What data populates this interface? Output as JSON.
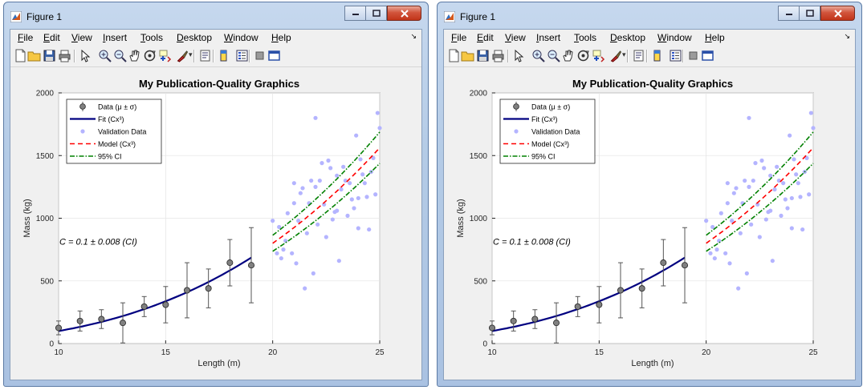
{
  "windows": [
    {
      "id": "left",
      "title": "Figure 1",
      "menu": [
        "File",
        "Edit",
        "View",
        "Insert",
        "Tools",
        "Desktop",
        "Window",
        "Help"
      ],
      "toolbar_icons": [
        "new-figure-icon",
        "open-file-icon",
        "save-icon",
        "print-icon",
        "edit-plot-icon",
        "zoom-in-icon",
        "zoom-out-icon",
        "pan-icon",
        "rotate-3d-icon",
        "data-cursor-icon",
        "brush-icon",
        "link-plot-icon",
        "insert-colorbar-icon",
        "insert-legend-icon",
        "hide-plot-tools-icon",
        "show-plot-tools-icon"
      ]
    },
    {
      "id": "right",
      "title": "Figure 1",
      "menu": [
        "File",
        "Edit",
        "View",
        "Insert",
        "Tools",
        "Desktop",
        "Window",
        "Help"
      ],
      "toolbar_icons": [
        "new-figure-icon",
        "open-file-icon",
        "save-icon",
        "print-icon",
        "edit-plot-icon",
        "zoom-in-icon",
        "zoom-out-icon",
        "pan-icon",
        "rotate-3d-icon",
        "data-cursor-icon",
        "brush-icon",
        "link-plot-icon",
        "insert-colorbar-icon",
        "insert-legend-icon",
        "hide-plot-tools-icon",
        "show-plot-tools-icon"
      ]
    }
  ],
  "chart_data": {
    "type": "scatter",
    "title": "My Publication-Quality Graphics",
    "xlabel": "Length (m)",
    "ylabel": "Mass (kg)",
    "xlim": [
      10,
      25
    ],
    "ylim": [
      0,
      2000
    ],
    "xticks": [
      "10",
      "15",
      "20",
      "25"
    ],
    "yticks": [
      "0",
      "500",
      "1000",
      "1500",
      "2000"
    ],
    "grid": true,
    "legend_position": "top-left",
    "annotation": "C = 0.1 ± 0.008 (CI)",
    "legend": [
      "Data (μ ± σ)",
      "Fit (Cx³)",
      "Validation Data",
      "Model (Cx³)",
      "95% CI"
    ],
    "colors": {
      "data": "#808080",
      "fit": "#000080",
      "validation": "#b4b4ff",
      "model": "#ff0000",
      "ci": "#008000"
    },
    "series": [
      {
        "name": "Data (μ ± σ)",
        "x": [
          10,
          11,
          12,
          13,
          14,
          15,
          16,
          17,
          18,
          19
        ],
        "y": [
          125,
          180,
          195,
          165,
          295,
          310,
          425,
          440,
          645,
          625
        ],
        "err": [
          55,
          80,
          75,
          160,
          80,
          145,
          220,
          155,
          185,
          300
        ]
      },
      {
        "name": "Fit (Cx³)",
        "fn": "0.1*x^3",
        "x_range": [
          10,
          19
        ]
      },
      {
        "name": "Validation Data",
        "x": [
          20.0,
          20.2,
          20.3,
          20.5,
          20.6,
          20.7,
          20.9,
          21.0,
          21.1,
          21.2,
          21.3,
          21.4,
          21.5,
          21.6,
          21.7,
          21.8,
          21.9,
          22.0,
          22.1,
          22.2,
          22.3,
          22.4,
          22.5,
          22.6,
          22.7,
          22.8,
          22.9,
          23.0,
          23.1,
          23.2,
          23.3,
          23.4,
          23.5,
          23.6,
          23.7,
          23.8,
          23.9,
          24.0,
          24.1,
          24.2,
          24.3,
          24.4,
          24.5,
          24.6,
          24.7,
          24.8,
          24.9,
          25.0,
          20.4,
          21.0,
          22.0,
          23.0,
          24.0
        ],
        "y": [
          980,
          720,
          930,
          750,
          820,
          1040,
          720,
          1280,
          640,
          980,
          1200,
          1240,
          440,
          880,
          1120,
          1300,
          560,
          1800,
          950,
          1300,
          1440,
          1110,
          850,
          1460,
          1400,
          990,
          1050,
          1340,
          660,
          1230,
          1410,
          1300,
          1020,
          1280,
          1150,
          1080,
          1660,
          920,
          1470,
          1350,
          1280,
          1170,
          910,
          1370,
          1480,
          1190,
          1840,
          1720,
          680,
          1120,
          1250,
          1060,
          1160
        ]
      },
      {
        "name": "Model (Cx³)",
        "fn": "0.1*x^3",
        "x_range": [
          20,
          25
        ]
      },
      {
        "name": "95% CI",
        "fn": "0.092*x^3 .. 0.108*x^3",
        "x_range": [
          20,
          25
        ]
      }
    ]
  }
}
